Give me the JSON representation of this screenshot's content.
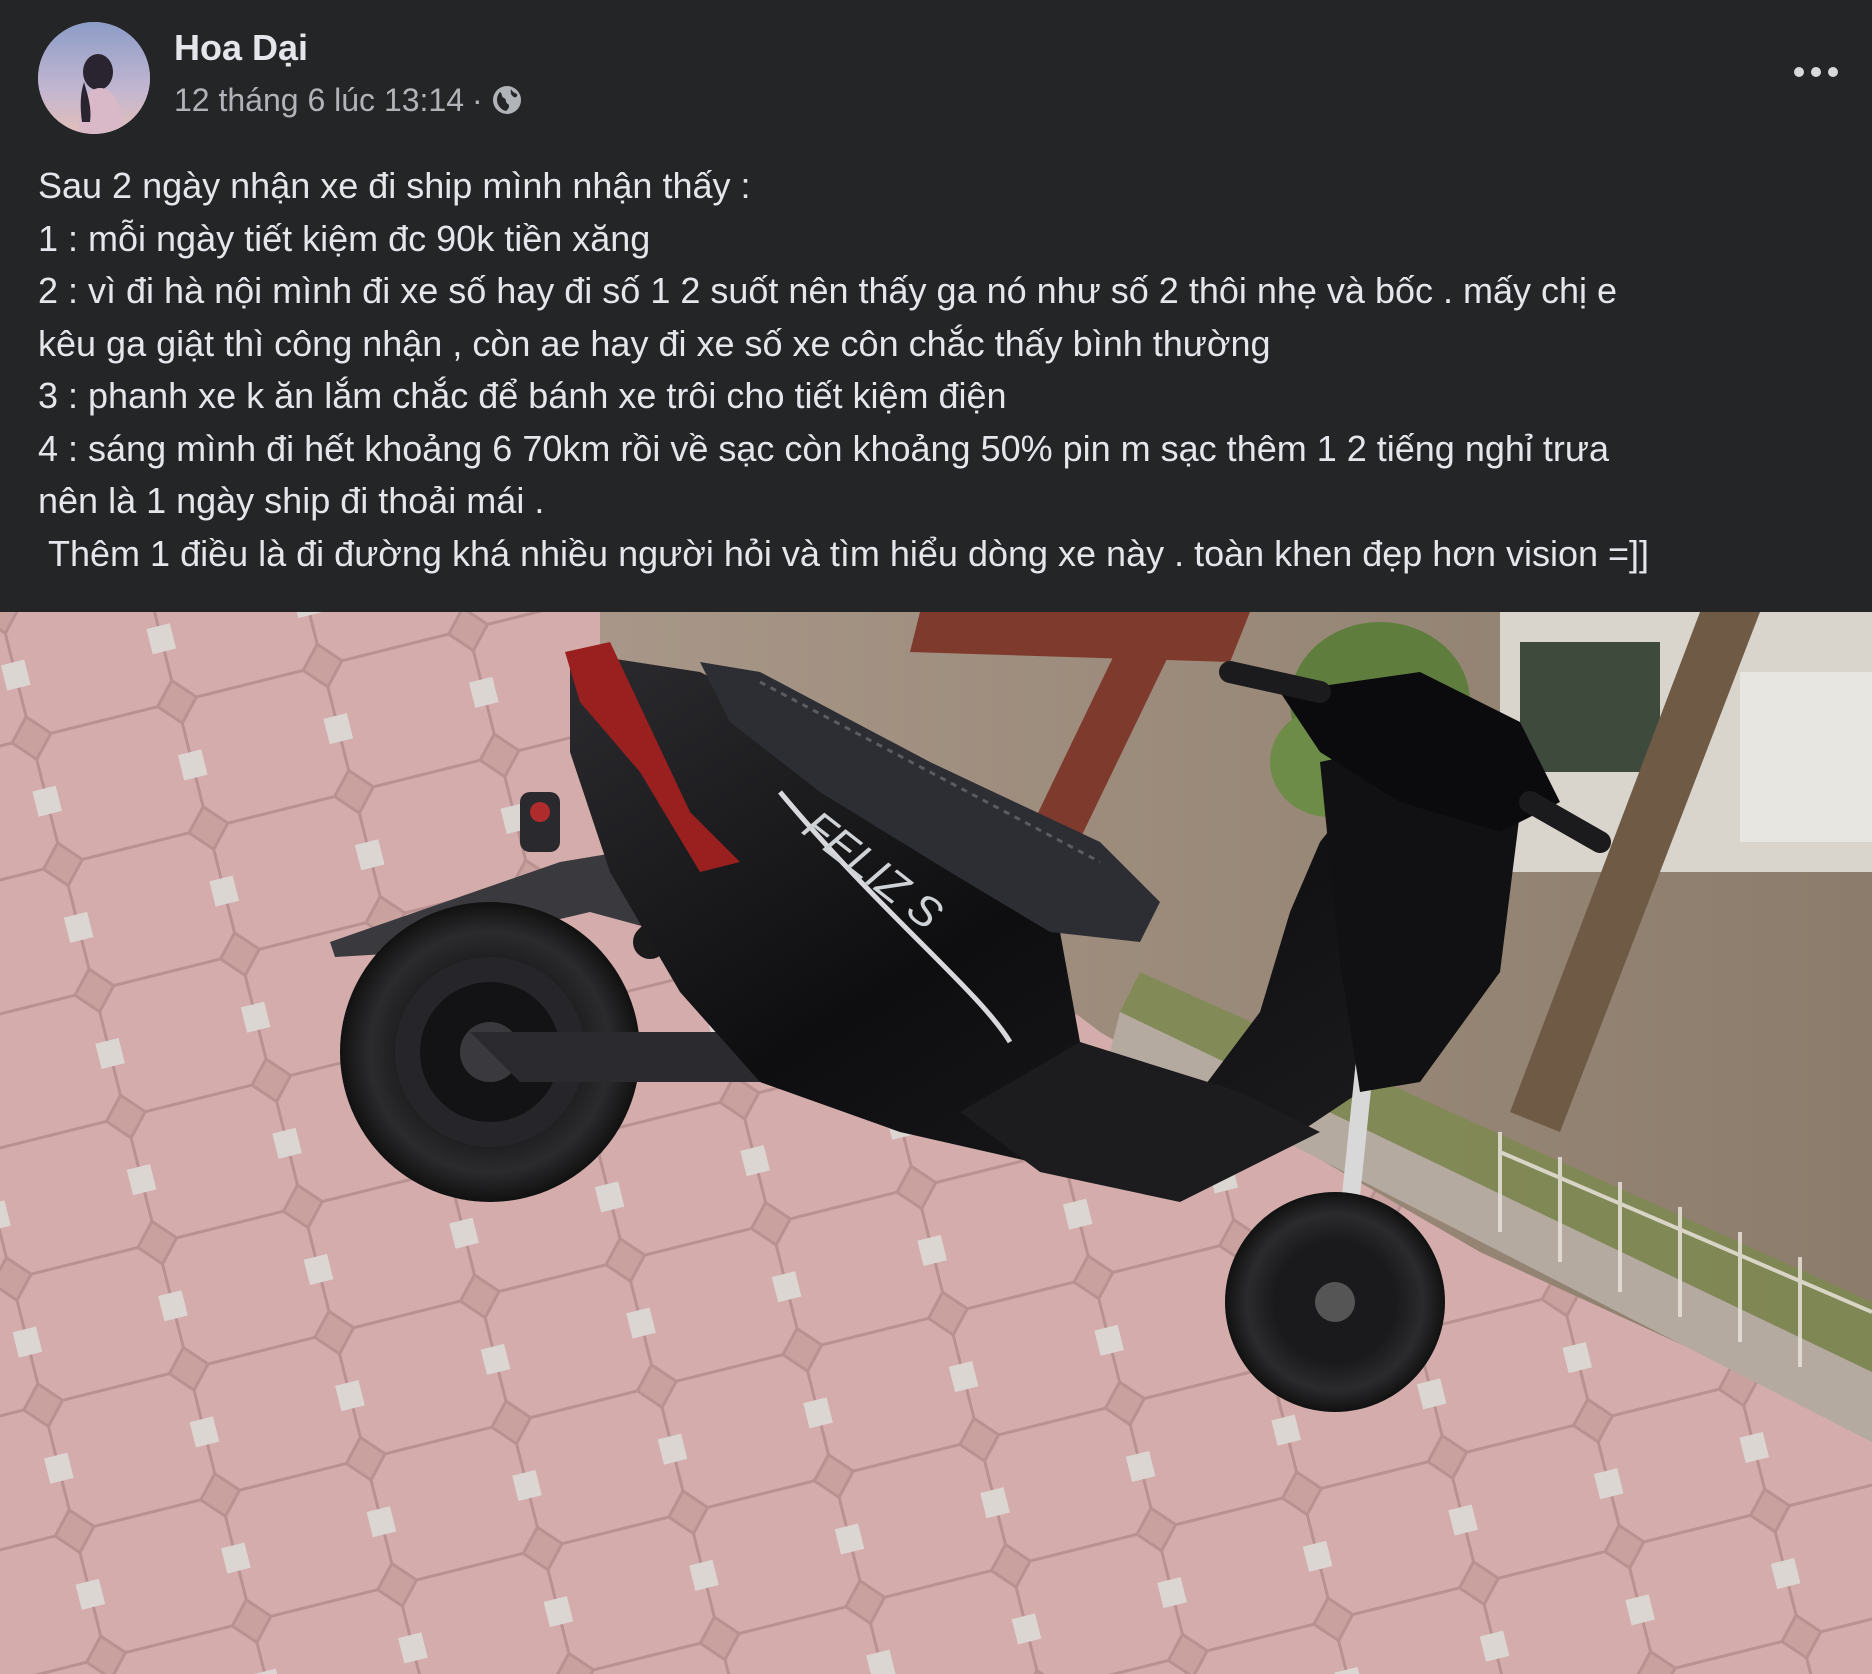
{
  "post": {
    "author": "Hoa Dại",
    "timestamp": "12 tháng 6 lúc 13:14",
    "separator": "·",
    "audience_icon": "globe-icon",
    "more_icon": "more-options-icon",
    "text_lines": [
      "Sau 2 ngày nhận xe đi ship mình nhận thấy :",
      "1 : mỗi ngày tiết kiệm đc 90k tiền xăng",
      "2 : vì đi hà nội mình đi xe số hay đi số 1 2 suốt nên thấy ga nó như số 2 thôi nhẹ và bốc . mấy chị e",
      "kêu ga giật thì công nhận , còn ae hay đi xe số xe côn chắc thấy bình thường",
      "3 : phanh xe k ăn lắm chắc để bánh xe trôi cho tiết kiệm điện",
      "4 : sáng mình đi hết khoảng 6 70km rồi về sạc còn khoảng 50% pin m sạc thêm 1 2 tiếng nghỉ trưa",
      "nên là 1 ngày ship đi thoải mái .",
      " Thêm 1 điều là đi đường khá nhiều người hỏi và tìm hiểu dòng xe này . toàn khen đẹp hơn vision =]]"
    ],
    "photo": {
      "subject": "black electric scooter on brick pavement",
      "scooter_badge": "FELIZ S"
    }
  },
  "colors": {
    "background": "#242526",
    "primary_text": "#e4e6eb",
    "secondary_text": "#b0b3b8"
  }
}
